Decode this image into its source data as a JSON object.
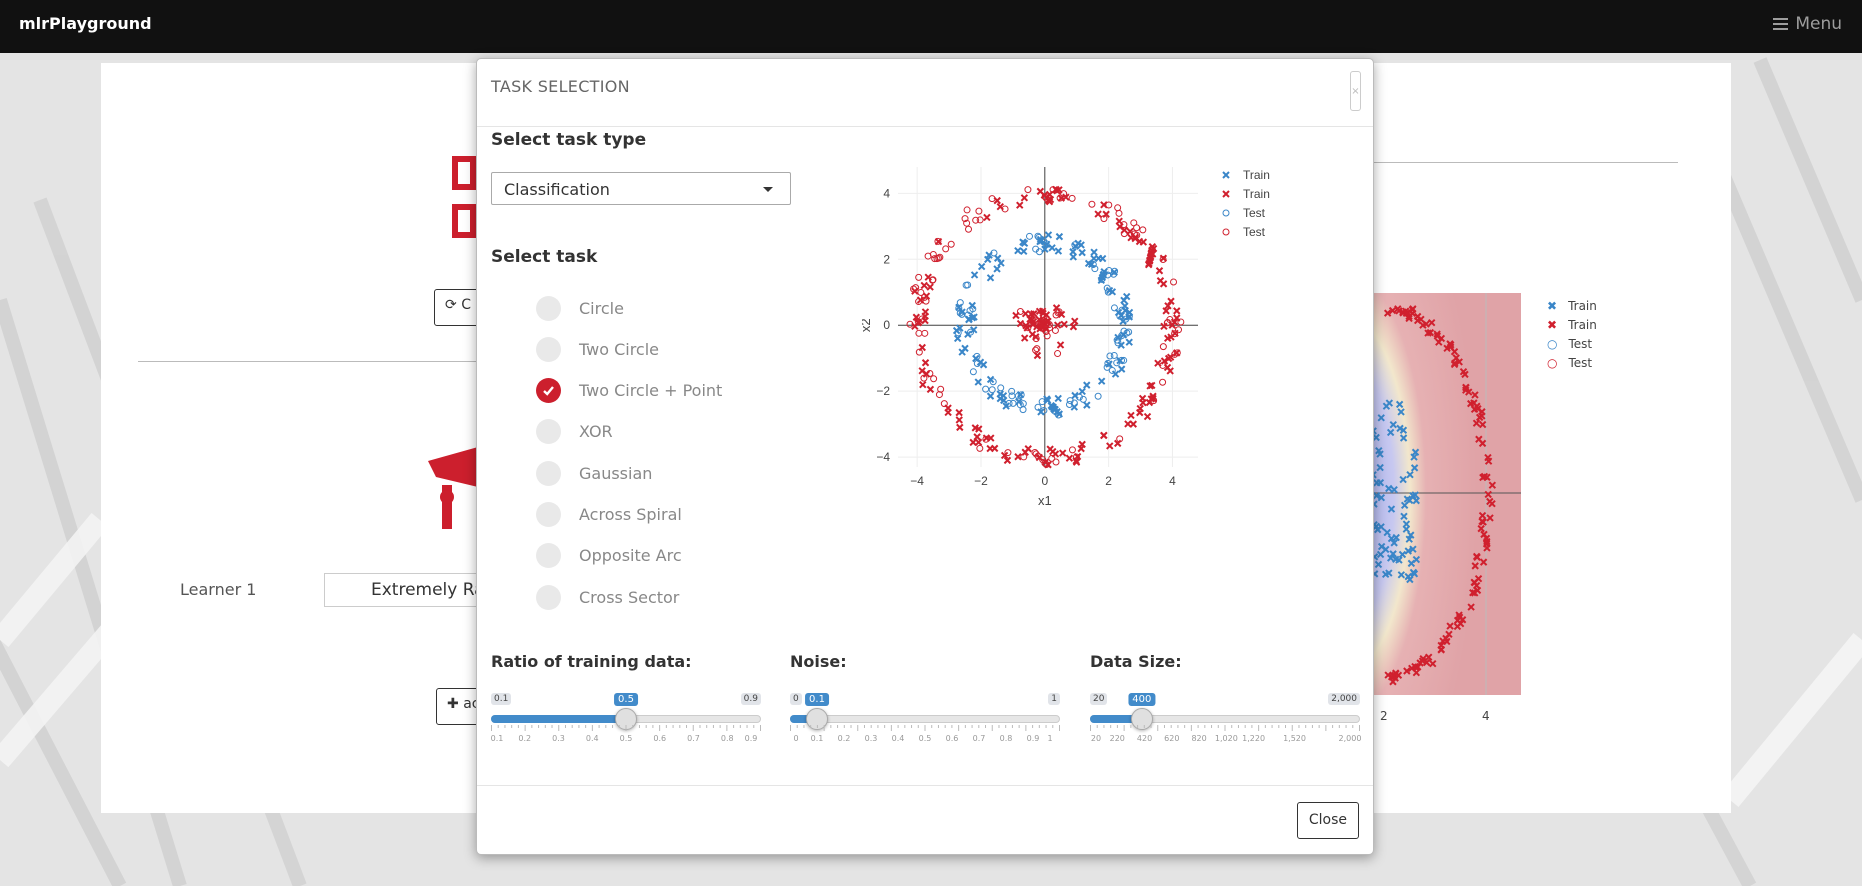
{
  "app": {
    "brand": "mlrPlayground",
    "menu_label": "Menu"
  },
  "background": {
    "change_button": "C",
    "learner_label": "Learner 1",
    "learner_value": "Extremely Ra",
    "add_button": "ac",
    "legend": [
      "Train",
      "Train",
      "Test",
      "Test"
    ],
    "x_ticks": [
      "2",
      "4"
    ]
  },
  "modal": {
    "title": "TASK SELECTION",
    "close_x": "×",
    "task_type_label": "Select task type",
    "task_type_value": "Classification",
    "task_label": "Select task",
    "tasks": [
      {
        "label": "Circle",
        "selected": false
      },
      {
        "label": "Two Circle",
        "selected": false
      },
      {
        "label": "Two Circle + Point",
        "selected": true
      },
      {
        "label": "XOR",
        "selected": false
      },
      {
        "label": "Gaussian",
        "selected": false
      },
      {
        "label": "Across Spiral",
        "selected": false
      },
      {
        "label": "Opposite Arc",
        "selected": false
      },
      {
        "label": "Cross Sector",
        "selected": false
      }
    ],
    "ratio": {
      "label": "Ratio of training data:",
      "min": "0.1",
      "max": "0.9",
      "value": "0.5",
      "value_num": 0.5,
      "min_num": 0.1,
      "max_num": 0.9,
      "ticks": [
        "0.1",
        "0.2",
        "0.3",
        "0.4",
        "0.5",
        "0.6",
        "0.7",
        "0.8",
        "0.9"
      ]
    },
    "noise": {
      "label": "Noise:",
      "min": "0",
      "max": "1",
      "value": "0.1",
      "value_num": 0.1,
      "min_num": 0,
      "max_num": 1,
      "ticks": [
        "0",
        "0.1",
        "0.2",
        "0.3",
        "0.4",
        "0.5",
        "0.6",
        "0.7",
        "0.8",
        "0.9",
        "1"
      ]
    },
    "size": {
      "label": "Data Size:",
      "min": "20",
      "max": "2,000",
      "value": "400",
      "value_num": 400,
      "min_num": 20,
      "max_num": 2000,
      "ticks": [
        "20",
        "220",
        "420",
        "620",
        "820",
        "1,020",
        "1,220",
        "1,520",
        "2,000"
      ]
    },
    "close_button": "Close"
  },
  "chart_data": {
    "type": "scatter",
    "xlabel": "x1",
    "ylabel": "x2",
    "xlim": [
      -4.6,
      4.8
    ],
    "ylim": [
      -4.3,
      4.8
    ],
    "x_ticks": [
      -4,
      -2,
      0,
      2,
      4
    ],
    "y_ticks": [
      -4,
      -2,
      0,
      2,
      4
    ],
    "x_tick_labels": [
      "−4",
      "−2",
      "0",
      "2",
      "4"
    ],
    "y_tick_labels": [
      "−4",
      "−2",
      "0",
      "2",
      "4"
    ],
    "legend": [
      {
        "name": "Train",
        "color": "#3a86c8",
        "marker": "x"
      },
      {
        "name": "Train",
        "color": "#d0202e",
        "marker": "x"
      },
      {
        "name": "Test",
        "color": "#3a86c8",
        "marker": "o"
      },
      {
        "name": "Test",
        "color": "#d0202e",
        "marker": "o"
      }
    ],
    "structure": {
      "outer_ring": {
        "class": "red",
        "radius": 4.0,
        "points": 220
      },
      "inner_ring": {
        "class": "blue",
        "radius": 2.5,
        "points": 180
      },
      "center_blob": {
        "class": "red",
        "radius": 0.6,
        "points": 60
      }
    }
  }
}
